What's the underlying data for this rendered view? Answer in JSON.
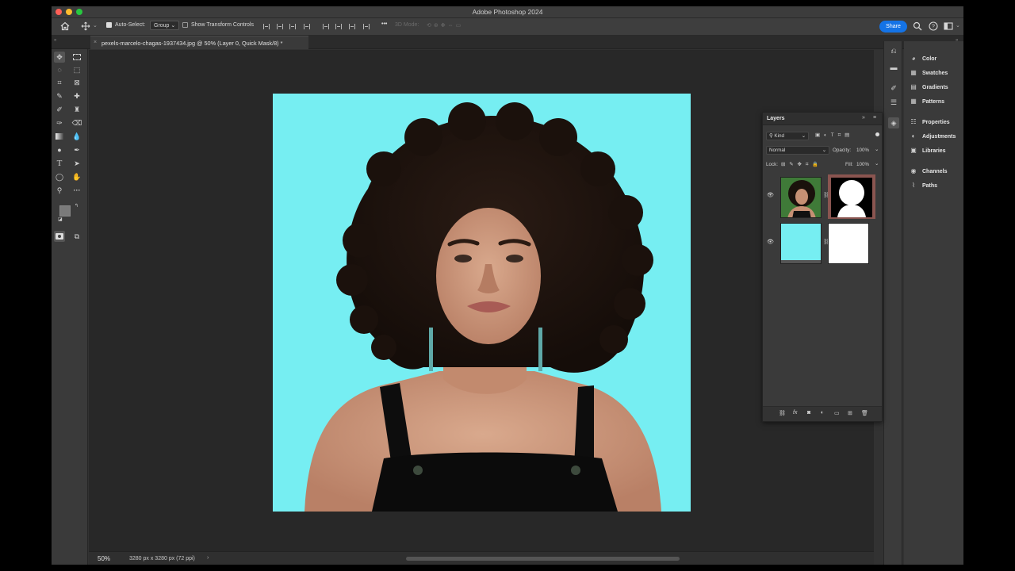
{
  "app": {
    "title": "Adobe Photoshop 2024"
  },
  "options_bar": {
    "auto_select_label": "Auto-Select:",
    "auto_select_checked": true,
    "auto_select_target": "Group",
    "transform_controls_label": "Show Transform Controls",
    "transform_controls_checked": false,
    "more_label": "•••",
    "mode_3d_label": "3D Mode:",
    "share_label": "Share"
  },
  "document": {
    "tab_title": "pexels-marcelo-chagas-1937434.jpg @ 50% (Layer 0, Quick Mask/8) *",
    "canvas_color": "#76eef2"
  },
  "status_bar": {
    "zoom": "50%",
    "dimensions": "3280 px x 3280 px (72 ppi)",
    "arrow": "›"
  },
  "right_panels": [
    {
      "label": "Color",
      "icon": "color-icon"
    },
    {
      "label": "Swatches",
      "icon": "swatches-icon"
    },
    {
      "label": "Gradients",
      "icon": "gradients-icon"
    },
    {
      "label": "Patterns",
      "icon": "patterns-icon"
    },
    {
      "label": "Properties",
      "icon": "properties-icon"
    },
    {
      "label": "Adjustments",
      "icon": "adjustments-icon"
    },
    {
      "label": "Libraries",
      "icon": "libraries-icon"
    },
    {
      "label": "Channels",
      "icon": "channels-icon"
    },
    {
      "label": "Paths",
      "icon": "paths-icon"
    }
  ],
  "layers_panel": {
    "title": "Layers",
    "filter_kind": "Kind",
    "blend_mode": "Normal",
    "opacity_label": "Opacity:",
    "opacity_value": "100%",
    "lock_label": "Lock:",
    "fill_label": "Fill:",
    "fill_value": "100%",
    "layers": [
      {
        "thumb": "photo",
        "mask": "silhouette",
        "visible": true,
        "selected": true
      },
      {
        "thumb": "solid-cyan",
        "mask": "white",
        "visible": true,
        "selected": false
      }
    ]
  },
  "colors": {
    "accent": "#1473e6",
    "canvas_bg": "#282828",
    "panel_bg": "#3a3a3a",
    "mask_selected_border": "#8a5550"
  }
}
